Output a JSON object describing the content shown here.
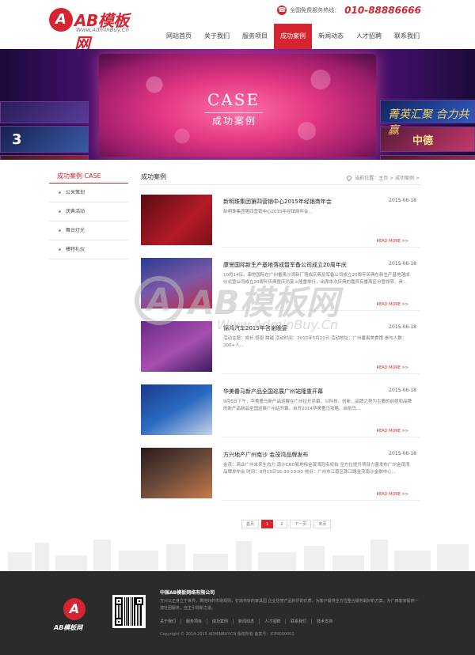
{
  "header": {
    "logo_badge": "A",
    "logo_text": "AB模板网",
    "logo_sub": "Www.AdminBuy.Cn",
    "hotline_label": "全国免费服务热线：",
    "hotline_number": "010-88886666"
  },
  "nav": [
    "网站首页",
    "关于我们",
    "服务项目",
    "成功案例",
    "新闻动态",
    "人才招聘",
    "联系我们"
  ],
  "banner": {
    "title_en": "CASE",
    "title_cn": "成功案例",
    "calligraphy": "菁英汇聚 合力共赢",
    "thumb_left_text": "3",
    "thumb_right_text": "中德"
  },
  "sidebar": {
    "title": "成功案例 CASE",
    "items": [
      "公关策划",
      "庆典活动",
      "舞台灯光",
      "模特礼仪"
    ]
  },
  "main": {
    "title": "成功案例",
    "breadcrumb": "当前位置：主页 > 成功案例 >",
    "more_label": "READ MORE >>",
    "cases": [
      {
        "title": "新明珠集团第四营销中心2015年经销商年会",
        "date": "2015-06-18",
        "desc": "新明珠集团第四营销中心2015年经销商年会..."
      },
      {
        "title": "康誉国际新生产基地落成暨军备公司成立20周年庆",
        "date": "2015-06-18",
        "desc": "10月14日，康誉国际在广州番禺沙湾新厂落成庆典及军备公司成立20周年庆典在新生产基地落成仪式暨公司成立20周年庆典暨庆功宴上隆重举行，出席本次庆典的嘉宾有番禺区分管领导、贵... "
      },
      {
        "title": "锦鸿汽车2015年答谢晚宴",
        "date": "2015-06-18",
        "desc": "活动主题：成长 感恩 跨越 活动时间：2015年5月21日 活动地址：广州番禺美食馆 参与人数：200+人..."
      },
      {
        "title": "华美罍马新产品全国巡展广州站隆重开幕",
        "date": "2015-06-18",
        "desc": "9月6日下午，华美罍马新产品巡展在广州拉开序幕，以科技、创新、品牌之势为主要的前提和品牌的新产品新品全国巡展广州站开幕，自开2014华美罍马攻略、启航马..."
      },
      {
        "title": "方兴地产广州南沙 金茂湾品牌发布",
        "date": "2015-06-18",
        "desc": "金茂：商业广州未来生态力 南沙CBD新地标金茂湾冠名权拍 全方位提升项目力量发布广州金茂湾品牌发布会 时间：8月15日16:30-19:00 地点：广州市江南区珠江路金茂南沙金融中心..."
      }
    ]
  },
  "pager": [
    "首页",
    "1",
    "2",
    "下一页",
    "末页"
  ],
  "watermark": {
    "badge": "A",
    "text": "AB模板网",
    "url": "Www.AdminBuy.Cn"
  },
  "footer": {
    "badge": "A",
    "logo_text": "AB模板网",
    "company": "中国AB模板网络有限公司",
    "intro": "方兴以正身立于世界，秉持好的市场规则，打造共好的家具园 企业信誉产品好评的优质，为客户提供全方位整合服务最好的方案，为广西客家提供一流社团服务，自主引领新之道。",
    "links": [
      "关于我们",
      "服务项目",
      "成功案例",
      "新闻动态",
      "人才招聘",
      "联系我们",
      "技术支持"
    ],
    "copyright": "Copyright © 2014-2015 ADMINBUY.CN  版权所有  备案号：ICP0000001"
  },
  "colors": {
    "accent": "#d42530",
    "footer_bg": "#2b2b2b"
  }
}
